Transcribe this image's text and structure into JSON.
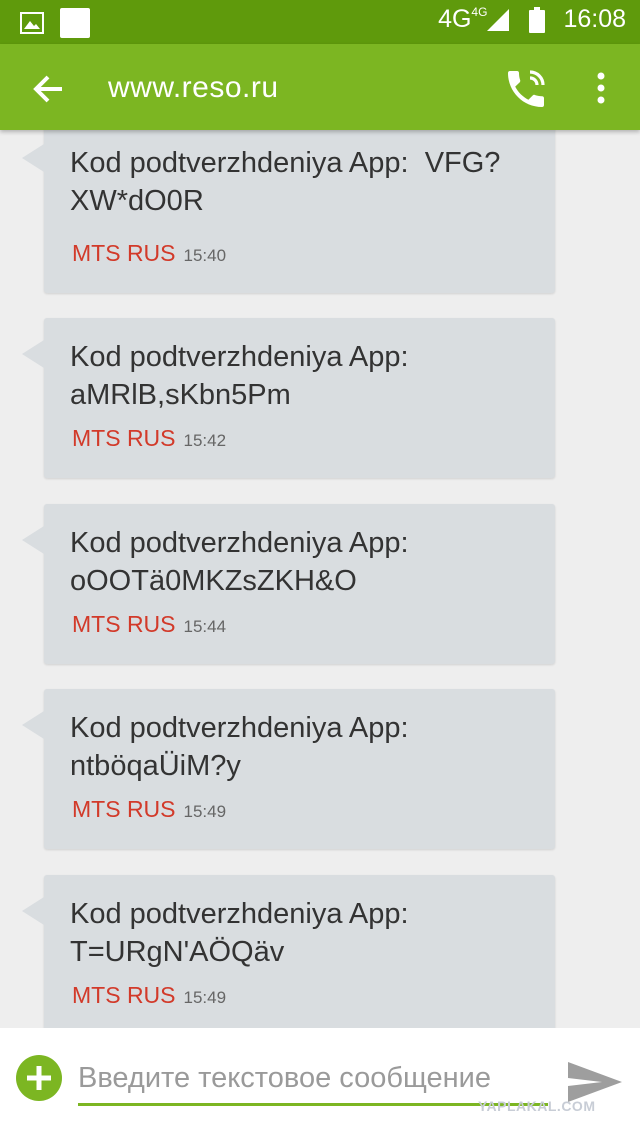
{
  "status_bar": {
    "network": "4G",
    "network_sub": "4G",
    "time": "16:08"
  },
  "app_bar": {
    "title": "www.reso.ru"
  },
  "messages": [
    {
      "text": "Kod podtverzhdeniya App:  VFG?\nXW*dO0R",
      "sender": "MTS RUS",
      "time": "15:40"
    },
    {
      "text": "Kod podtverzhdeniya App:\naMRlB,sKbn5Pm",
      "sender": "MTS RUS",
      "time": "15:42"
    },
    {
      "text": "Kod podtverzhdeniya App:\noOOTä0MKZsZKH&O",
      "sender": "MTS RUS",
      "time": "15:44"
    },
    {
      "text": "Kod podtverzhdeniya App:\nntböqaÜiM?y",
      "sender": "MTS RUS",
      "time": "15:49"
    },
    {
      "text": "Kod podtverzhdeniya App:\nT=URgN'AÖQäv",
      "sender": "MTS RUS",
      "time": "15:49"
    }
  ],
  "compose": {
    "placeholder": "Введите текстовое сообщение",
    "value": ""
  },
  "watermark": "YAPLAKAL.COM",
  "colors": {
    "status_bar": "#5f9a0c",
    "app_bar": "#7cb622",
    "bubble": "#d9dde0",
    "sender": "#d23a2a"
  },
  "icons": {
    "back": "arrow-left-icon",
    "call": "phone-icon",
    "more": "more-vert-icon",
    "attach": "plus-icon",
    "send": "send-icon"
  }
}
